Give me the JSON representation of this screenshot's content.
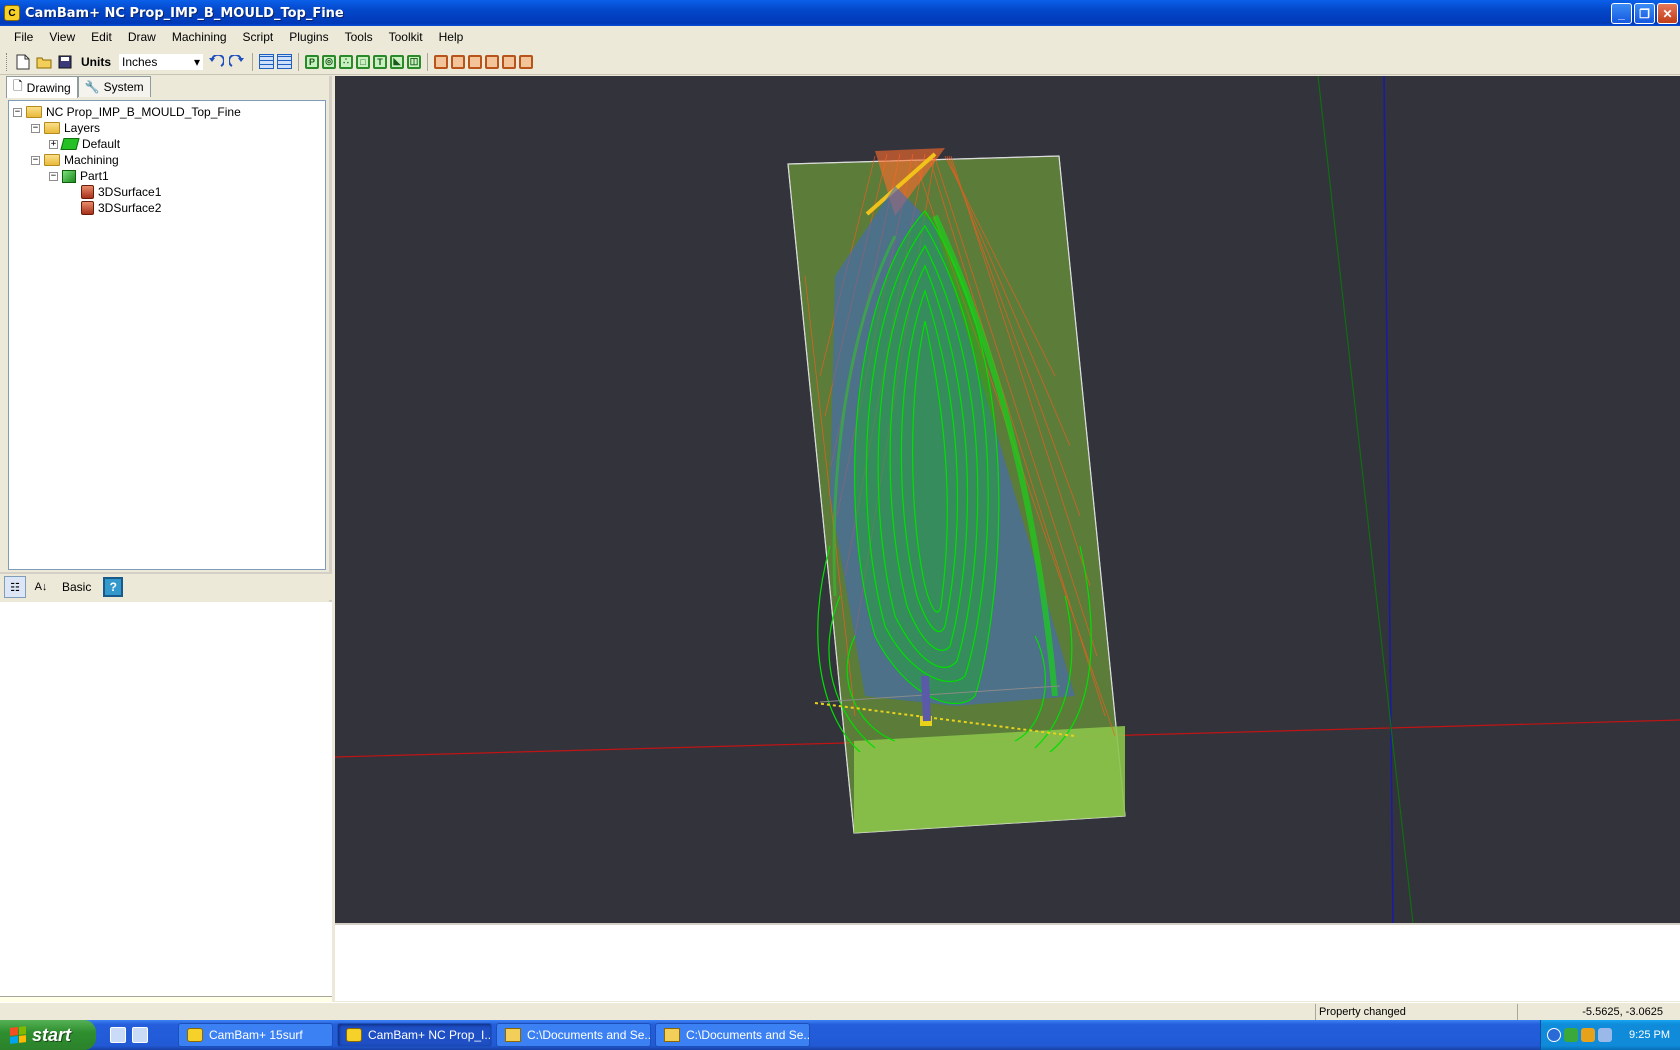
{
  "window": {
    "title": "CamBam+  NC Prop_IMP_B_MOULD_Top_Fine",
    "app_icon": "cambam-icon",
    "buttons": {
      "minimize": "_",
      "restore": "❐",
      "close": "✕"
    }
  },
  "menu": [
    "File",
    "View",
    "Edit",
    "Draw",
    "Machining",
    "Script",
    "Plugins",
    "Tools",
    "Toolkit",
    "Help"
  ],
  "toolbar": {
    "units_label": "Units",
    "units_value": "Inches",
    "dropdown_arrow": "▾",
    "green_tools": [
      "P",
      "◎",
      "∴",
      "□",
      "T",
      "◣",
      "◫"
    ]
  },
  "left_panel": {
    "tabs": [
      {
        "label": "Drawing",
        "icon": "page-icon",
        "glyph": "🗋"
      },
      {
        "label": "System",
        "icon": "wrench-icon",
        "glyph": "🔧"
      }
    ],
    "tree": {
      "root": "NC Prop_IMP_B_MOULD_Top_Fine",
      "layers": "Layers",
      "default_layer": "Default",
      "machining": "Machining",
      "part": "Part1",
      "ops": [
        "3DSurface1",
        "3DSurface2"
      ],
      "collapse": "−",
      "expand": "+"
    },
    "property_toolbar": {
      "categorized_glyph": "☷",
      "sort_az_glyph": "A↓",
      "mode_label": "Basic",
      "help_glyph": "?"
    },
    "info_close": "✕"
  },
  "viewport": {
    "background": "#32333b",
    "toolpath_colors": {
      "stock_green": "#8bc34a",
      "toolpath_green": "#00e000",
      "rapid_orange": "#ff5a1a",
      "axis_red": "#d01010",
      "axis_blue": "#1a1aa8",
      "axis_green": "#0f7a0f"
    }
  },
  "status": {
    "message": "Property changed",
    "coordinates": "-5.5625, -3.0625"
  },
  "taskbar": {
    "start": "start",
    "tasks": [
      {
        "label": "CamBam+ 15surf",
        "icon": "cambam-icon"
      },
      {
        "label": "CamBam+  NC Prop_I...",
        "icon": "cambam-icon"
      },
      {
        "label": "C:\\Documents and Se...",
        "icon": "folder-icon"
      },
      {
        "label": "C:\\Documents and Se...",
        "icon": "folder-icon"
      }
    ],
    "clock": "9:25 PM"
  }
}
